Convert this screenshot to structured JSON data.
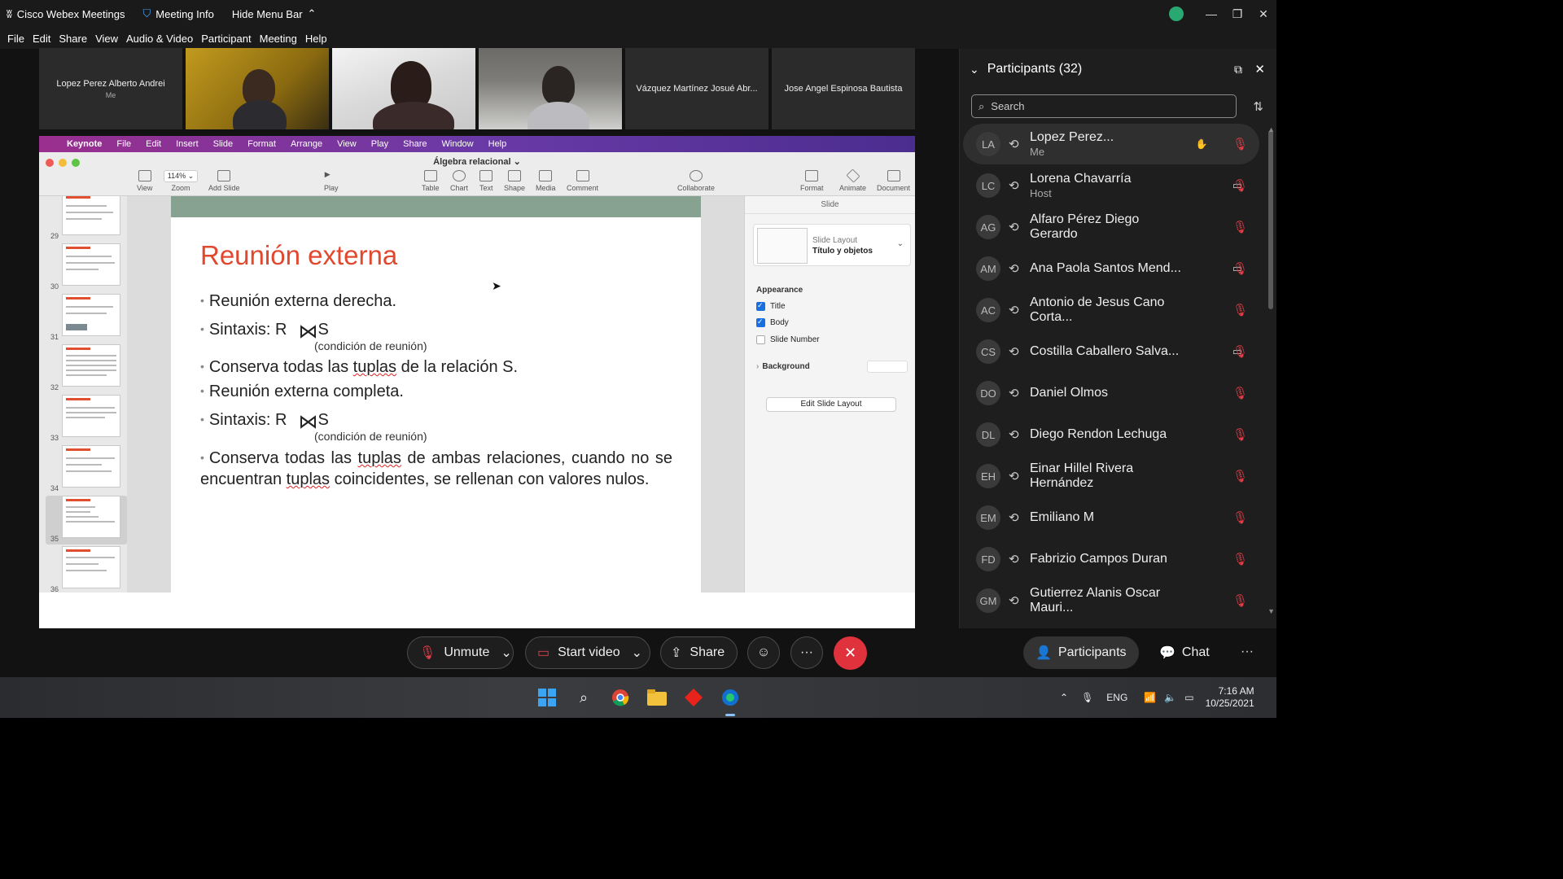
{
  "titlebar": {
    "app_name": "Cisco Webex Meetings",
    "meeting_info": "Meeting Info",
    "hide_menu_bar": "Hide Menu Bar"
  },
  "menubar": [
    "File",
    "Edit",
    "Share",
    "View",
    "Audio & Video",
    "Participant",
    "Meeting",
    "Help"
  ],
  "video_strip": [
    {
      "name": "Lopez Perez Alberto Andrei",
      "sub": "Me",
      "type": "name"
    },
    {
      "type": "video"
    },
    {
      "type": "video"
    },
    {
      "type": "video"
    },
    {
      "name": "Vázquez Martínez Josué Abr...",
      "type": "name"
    },
    {
      "name": "Jose Angel Espinosa Bautista",
      "type": "name"
    }
  ],
  "keynote": {
    "menu": [
      "Keynote",
      "File",
      "Edit",
      "Insert",
      "Slide",
      "Format",
      "Arrange",
      "View",
      "Play",
      "Share",
      "Window",
      "Help"
    ],
    "doc_title": "Álgebra relacional ⌄",
    "toolbar": {
      "view": "View",
      "zoom_value": "114% ⌄",
      "zoom": "Zoom",
      "add_slide": "Add Slide",
      "play": "Play",
      "table": "Table",
      "chart": "Chart",
      "text": "Text",
      "shape": "Shape",
      "media": "Media",
      "comment": "Comment",
      "collaborate": "Collaborate",
      "format": "Format",
      "animate": "Animate",
      "document": "Document"
    },
    "slide_numbers": [
      "29",
      "30",
      "31",
      "32",
      "33",
      "34",
      "35",
      "36"
    ],
    "slide": {
      "title": "Reunión externa",
      "b1": "Reunión externa derecha.",
      "b2_prefix": "Sintaxis:  R",
      "b2_suffix": "S",
      "cond1": "(condición de reunión)",
      "b3_pre": "Conserva todas las ",
      "b3_sq": "tuplas",
      "b3_post": " de la relación S.",
      "b4": "Reunión externa completa.",
      "b5_prefix": "Sintaxis: R",
      "b5_suffix": "S",
      "cond2": "(condición de reunión)",
      "b6_a": "Conserva todas las ",
      "b6_sq1": "tuplas",
      "b6_b": " de ambas relaciones, cuando no se encuentran ",
      "b6_sq2": "tuplas",
      "b6_c": " coincidentes, se rellenan con valores nulos."
    },
    "inspector": {
      "header": "Slide",
      "layout_label": "Slide Layout",
      "layout_value": "Título y objetos",
      "appearance": "Appearance",
      "title_chk": "Title",
      "body_chk": "Body",
      "slide_number_chk": "Slide Number",
      "background": "Background",
      "edit_layout": "Edit Slide Layout"
    }
  },
  "participants": {
    "header": "Participants (32)",
    "search_placeholder": "Search",
    "list": [
      {
        "initials": "LA",
        "name": "Lopez Perez...",
        "role": "Me",
        "video": false
      },
      {
        "initials": "LC",
        "name": "Lorena Chavarría",
        "role": "Host",
        "video": true
      },
      {
        "initials": "AG",
        "name": "Alfaro Pérez Diego Gerardo",
        "role": "",
        "video": false
      },
      {
        "initials": "AM",
        "name": "Ana Paola Santos Mend...",
        "role": "",
        "video": true
      },
      {
        "initials": "AC",
        "name": "Antonio de Jesus Cano Corta...",
        "role": "",
        "video": false
      },
      {
        "initials": "CS",
        "name": "Costilla Caballero Salva...",
        "role": "",
        "video": true
      },
      {
        "initials": "DO",
        "name": "Daniel Olmos",
        "role": "",
        "video": false
      },
      {
        "initials": "DL",
        "name": "Diego Rendon Lechuga",
        "role": "",
        "video": false
      },
      {
        "initials": "EH",
        "name": "Einar Hillel Rivera Hernández",
        "role": "",
        "video": false
      },
      {
        "initials": "EM",
        "name": "Emiliano M",
        "role": "",
        "video": false
      },
      {
        "initials": "FD",
        "name": "Fabrizio Campos Duran",
        "role": "",
        "video": false
      },
      {
        "initials": "GM",
        "name": "Gutierrez Alanis Oscar Mauri...",
        "role": "",
        "video": false
      }
    ]
  },
  "controls": {
    "unmute": "Unmute",
    "start_video": "Start video",
    "share": "Share",
    "participants": "Participants",
    "chat": "Chat"
  },
  "taskbar": {
    "lang": "ENG",
    "time": "7:16 AM",
    "date": "10/25/2021"
  },
  "colors": {
    "leave_red": "#e0323d",
    "slide_title": "#e0482f",
    "muted_red": "#e0404a"
  }
}
